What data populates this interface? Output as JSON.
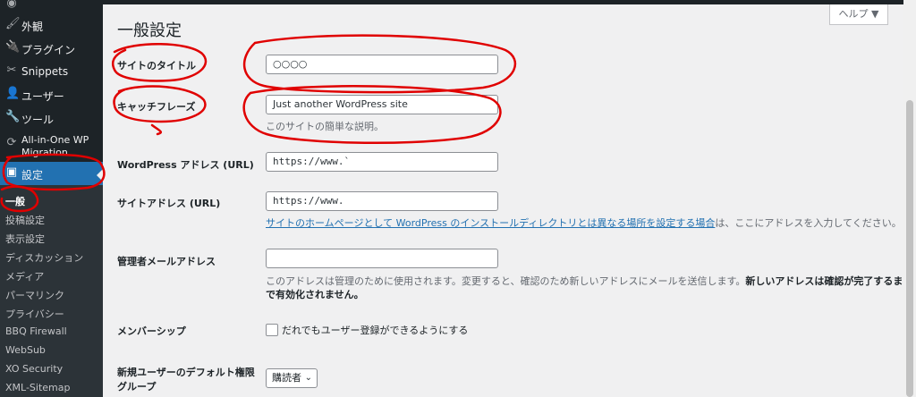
{
  "sidebar": {
    "items": [
      {
        "icon": "appearance-icon",
        "glyph": "🖌",
        "label": "外観"
      },
      {
        "icon": "plugins-icon",
        "glyph": "🔌",
        "label": "プラグイン"
      },
      {
        "icon": "snippets-icon",
        "glyph": "✂",
        "label": "Snippets"
      },
      {
        "icon": "users-icon",
        "glyph": "👤",
        "label": "ユーザー"
      },
      {
        "icon": "tools-icon",
        "glyph": "🔧",
        "label": "ツール"
      },
      {
        "icon": "migration-icon",
        "glyph": "⟳",
        "label_line1": "All-in-One WP",
        "label_line2": "Migration"
      },
      {
        "icon": "settings-icon",
        "glyph": "▣",
        "label": "設定"
      }
    ],
    "submenu": [
      "一般",
      "投稿設定",
      "表示設定",
      "ディスカッション",
      "メディア",
      "パーマリンク",
      "プライバシー",
      "BBQ Firewall",
      "WebSub",
      "XO Security",
      "XML-Sitemap"
    ]
  },
  "main": {
    "title": "一般設定",
    "help": "ヘルプ ▼",
    "fields": {
      "site_title": {
        "label": "サイトのタイトル",
        "value": "○○○○"
      },
      "tagline": {
        "label": "キャッチフレーズ",
        "value": "Just another WordPress site",
        "desc": "このサイトの簡単な説明。"
      },
      "wp_address": {
        "label": "WordPress アドレス (URL)",
        "value": "https://www.`"
      },
      "site_address": {
        "label": "サイトアドレス (URL)",
        "value": "https://www.",
        "desc_link": "サイトのホームページとして WordPress のインストールディレクトリとは異なる場所を設定する場合",
        "desc_rest": "は、ここにアドレスを入力してください。"
      },
      "admin_email": {
        "label": "管理者メールアドレス",
        "value": "",
        "desc1": "このアドレスは管理のために使用されます。変更すると、確認のため新しいアドレスにメールを送信します。",
        "desc1_bold": "新しいアドレスは確認が完了するま",
        "desc2_bold": "で有効化されません。"
      },
      "membership": {
        "label": "メンバーシップ",
        "checkbox_label": "だれでもユーザー登録ができるようにする",
        "checked": false
      },
      "default_role": {
        "label_line1": "新規ユーザーのデフォルト権限",
        "label_line2": "グループ",
        "value": "購読者"
      }
    }
  },
  "colors": {
    "sidebar": "#1d2327",
    "active": "#2271b1",
    "annotation": "#e00000"
  }
}
